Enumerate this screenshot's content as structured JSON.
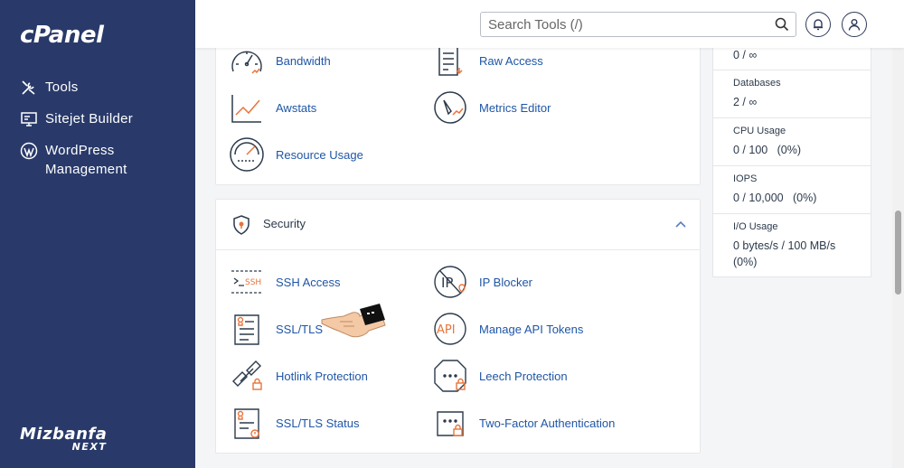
{
  "app": {
    "logo": "cPanel",
    "brand_main": "Mizbanfa",
    "brand_sub": "NEXT"
  },
  "sidebar": {
    "items": [
      {
        "label": "Tools",
        "icon": "tools-icon"
      },
      {
        "label": "Sitejet Builder",
        "icon": "sitejet-icon"
      },
      {
        "label": "WordPress Management",
        "icon": "wordpress-icon"
      }
    ]
  },
  "search": {
    "placeholder": "Search Tools (/)"
  },
  "metrics_section": {
    "items": [
      {
        "label": "Bandwidth",
        "icon": "bandwidth-icon"
      },
      {
        "label": "Raw Access",
        "icon": "raw-access-icon"
      },
      {
        "label": "Awstats",
        "icon": "awstats-icon"
      },
      {
        "label": "Metrics Editor",
        "icon": "metrics-editor-icon"
      },
      {
        "label": "Resource Usage",
        "icon": "resource-usage-icon"
      }
    ]
  },
  "security_section": {
    "title": "Security",
    "items": [
      {
        "label": "SSH Access",
        "icon": "ssh-icon"
      },
      {
        "label": "IP Blocker",
        "icon": "ip-blocker-icon"
      },
      {
        "label": "SSL/TLS",
        "icon": "ssl-tls-icon"
      },
      {
        "label": "Manage API Tokens",
        "icon": "api-tokens-icon"
      },
      {
        "label": "Hotlink Protection",
        "icon": "hotlink-icon"
      },
      {
        "label": "Leech Protection",
        "icon": "leech-icon"
      },
      {
        "label": "SSL/TLS Status",
        "icon": "ssl-status-icon"
      },
      {
        "label": "Two-Factor Authentication",
        "icon": "two-factor-icon"
      }
    ]
  },
  "stats": [
    {
      "name": "",
      "value": "0 / ∞"
    },
    {
      "name": "Databases",
      "value": "2 / ∞"
    },
    {
      "name": "CPU Usage",
      "value": "0 / 100   (0%)"
    },
    {
      "name": "IOPS",
      "value": "0 / 10,000   (0%)"
    },
    {
      "name": "I/O Usage",
      "value": "0 bytes/s / 100 MB/s (0%)"
    }
  ],
  "colors": {
    "sidebar": "#293a6a",
    "link": "#1f56a6",
    "accent": "#e8743b"
  }
}
